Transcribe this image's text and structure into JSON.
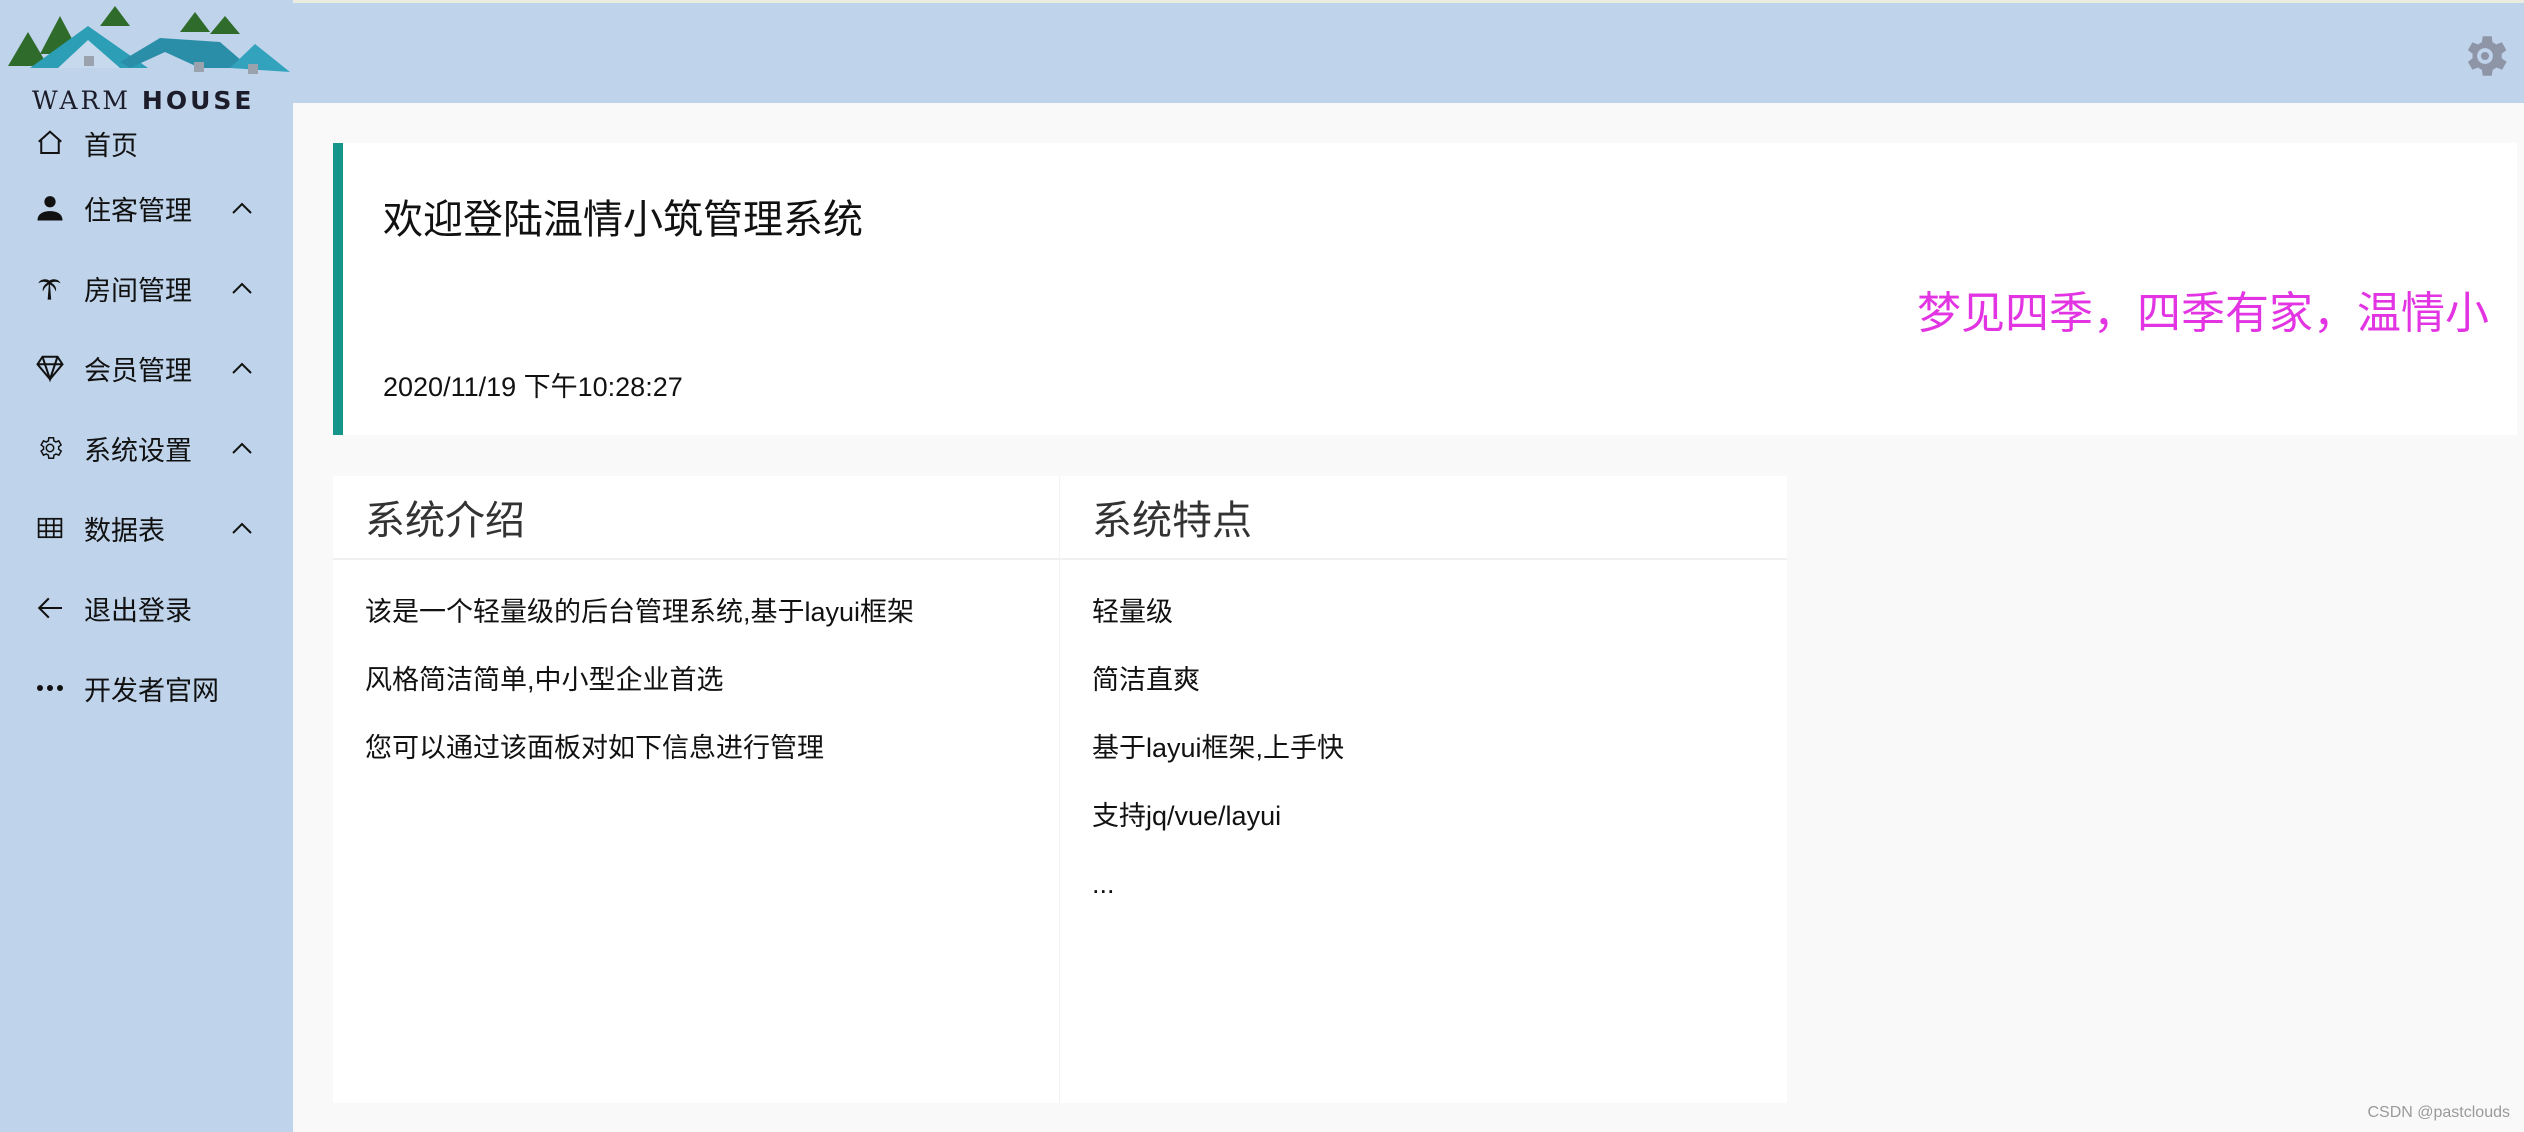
{
  "brand": {
    "logo_word_1": "WARM",
    "logo_word_2": "HOUSE",
    "colors": {
      "header_bg": "#bfd3ea",
      "accent": "#16958a",
      "marquee": "#e234e2"
    }
  },
  "header": {
    "settings_icon": "gear-icon"
  },
  "sidebar": {
    "items": [
      {
        "label": "首页",
        "icon": "home-icon",
        "expandable": false
      },
      {
        "label": "住客管理",
        "icon": "user-icon",
        "expandable": true
      },
      {
        "label": "房间管理",
        "icon": "palm-tree-icon",
        "expandable": true
      },
      {
        "label": "会员管理",
        "icon": "diamond-icon",
        "expandable": true
      },
      {
        "label": "系统设置",
        "icon": "gear-icon",
        "expandable": true
      },
      {
        "label": "数据表",
        "icon": "table-icon",
        "expandable": true
      },
      {
        "label": "退出登录",
        "icon": "arrow-left-icon",
        "expandable": false
      },
      {
        "label": "开发者官网",
        "icon": "more-icon",
        "expandable": false
      }
    ]
  },
  "welcome": {
    "title": "欢迎登陆温情小筑管理系统",
    "datetime": "2020/11/19 下午10:28:27",
    "marquee": "梦见四季，四季有家，温情小"
  },
  "panels": {
    "intro": {
      "title": "系统介绍",
      "lines": [
        "该是一个轻量级的后台管理系统,基于layui框架",
        "风格简洁简单,中小型企业首选",
        "您可以通过该面板对如下信息进行管理"
      ]
    },
    "features": {
      "title": "系统特点",
      "lines": [
        "轻量级",
        "简洁直爽",
        "基于layui框架,上手快",
        "支持jq/vue/layui",
        "..."
      ]
    }
  },
  "watermark": "CSDN @pastclouds"
}
